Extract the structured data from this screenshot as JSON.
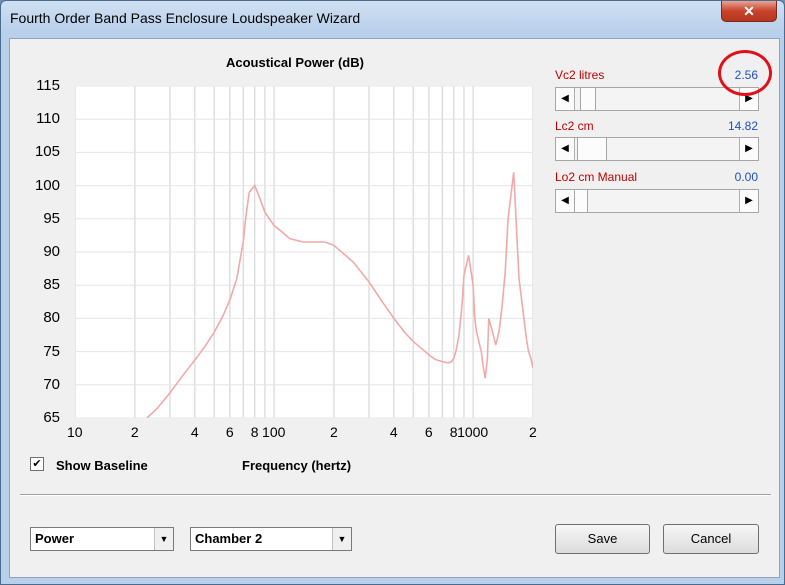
{
  "window": {
    "title": "Fourth Order Band Pass Enclosure Loudspeaker Wizard",
    "close_label": "✕"
  },
  "chart_data": {
    "type": "line",
    "title": "Acoustical Power (dB)",
    "xlabel": "Frequency (hertz)",
    "ylabel": "",
    "xscale": "log",
    "xlim": [
      10,
      2000
    ],
    "ylim": [
      65,
      115
    ],
    "yticks": [
      "115",
      "110",
      "105",
      "100",
      "95",
      "90",
      "85",
      "80",
      "75",
      "70",
      "65"
    ],
    "xticks": [
      "10",
      "2",
      "4",
      "6",
      "8",
      "100",
      "2",
      "4",
      "6",
      "8",
      "1000",
      "2"
    ],
    "grid": true,
    "series": [
      {
        "color": "#f1a9a9",
        "x": [
          23,
          26,
          30,
          35,
          40,
          45,
          50,
          55,
          60,
          65,
          70,
          72,
          75,
          80,
          85,
          90,
          100,
          110,
          120,
          140,
          160,
          180,
          200,
          250,
          300,
          350,
          400,
          450,
          500,
          550,
          600,
          650,
          700,
          750,
          780,
          800,
          820,
          850,
          880,
          900,
          950,
          1000,
          1020,
          1040,
          1060,
          1080,
          1100,
          1120,
          1150,
          1180,
          1200,
          1250,
          1300,
          1350,
          1400,
          1450,
          1500,
          1600,
          1700,
          1800,
          1850,
          1900,
          1950,
          2000
        ],
        "y": [
          65,
          66.5,
          68.8,
          71.5,
          73.7,
          75.8,
          77.9,
          80.2,
          82.8,
          86,
          91.5,
          95,
          99,
          100,
          98,
          96,
          94,
          93,
          92,
          91.5,
          91.5,
          91.5,
          91,
          88.5,
          85.5,
          82.5,
          80,
          78,
          76.5,
          75.5,
          74.5,
          73.8,
          73.5,
          73.3,
          73.5,
          74,
          75,
          77.5,
          82,
          86.5,
          89.5,
          85,
          80,
          78,
          77,
          76,
          75,
          73,
          71,
          74,
          80,
          78,
          76,
          78,
          82,
          87,
          95,
          102,
          86,
          80,
          77,
          75,
          74,
          72.5
        ]
      }
    ]
  },
  "baseline": {
    "checked": true,
    "check_glyph": "✔",
    "label": "Show Baseline"
  },
  "params": [
    {
      "label": "Vc2  litres",
      "value": "2.56",
      "thumb_fraction": 0.02
    },
    {
      "label": "Lc2  cm",
      "value": "14.82",
      "thumb_fraction": 0.08
    },
    {
      "label": "Lo2  cm  Manual",
      "value": "0.00",
      "thumb_fraction": 0.0
    }
  ],
  "highlight": {
    "color": "#e0101a",
    "target": "Vc2 value"
  },
  "bottom": {
    "left_combo": "Power",
    "right_combo": "Chamber 2",
    "save_label": "Save",
    "cancel_label": "Cancel"
  }
}
